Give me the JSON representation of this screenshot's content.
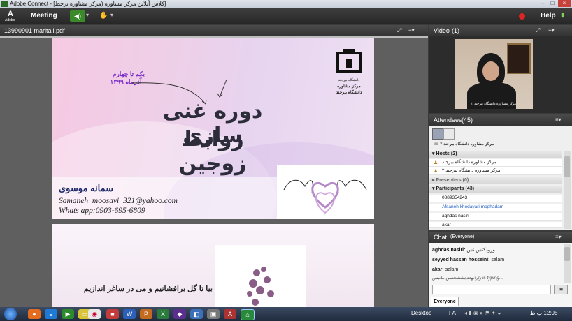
{
  "window": {
    "title": "[کلاس آنلاین مرکز مشاوره (مرکز مشاوره برخط] - Adobe Connect",
    "adobe_label": "Adobe",
    "minimize": "–",
    "maximize": "□",
    "close": "×"
  },
  "menubar": {
    "meeting": "Meeting",
    "help": "Help",
    "record_color": "#e02424"
  },
  "share_pod": {
    "title": "13990901 maritall.pdf",
    "slide1": {
      "date_line1": "یکم تا چهارم",
      "date_line2": "آذرماه ۱۳۹۹",
      "title_line1": "دوره غنی سازی",
      "title_line2": "روابط زوجین",
      "logo_line1": "دانشگاه بیرجند",
      "logo_line2": "مرکز مشاوره",
      "logo_line3": "دانشگاه بیرجند",
      "presenter_name": "سمانه موسوی",
      "email": "Samaneh_moosavi_321@yahoo.com",
      "whatsapp": "Whats app:0903-695-6809"
    },
    "slide2": {
      "text": "بیا تا گل برافشانیم و می در ساغر اندازیم"
    }
  },
  "video_pod": {
    "title": "Video",
    "count": "(1)",
    "caption": "مرکز مشاوره دانشگاه بیرجند ۲"
  },
  "attendees_pod": {
    "title": "Attendees",
    "count": "(45)",
    "me": "مرکز مشاوره دانشگاه بیرجند ۲",
    "hosts_label": "Hosts",
    "hosts_count": "(2)",
    "hosts": [
      "مرکز مشاوره دانشگاه بیرجند",
      "مرکز مشاوره دانشگاه بیرجند ۲"
    ],
    "presenters_label": "Presenters",
    "presenters_count": "(0)",
    "participants_label": "Participants",
    "participants_count": "(43)",
    "participants": [
      "0889354243",
      "Afsaneh khodayari moghadam",
      "aghdas nasiri",
      "akar"
    ]
  },
  "chat_pod": {
    "title": "Chat",
    "scope": "(Everyone)",
    "messages": [
      {
        "name": "aghdas nasiri:",
        "text": "ورودکنس نس"
      },
      {
        "name": "seyyed hassan hosseini:",
        "text": "salam"
      },
      {
        "name": "akar:",
        "text": "salam"
      }
    ],
    "typing": "زارانهعده‌ششحسن مانیس is typing...",
    "tab": "Everyone"
  },
  "taskbar": {
    "desktop": "Desktop",
    "lang": "FA",
    "clock": "12:05 ب.ظ"
  },
  "colors": {
    "accent_blue": "#1f5fbf",
    "title_dark": "#2c2c3a",
    "presenter_navy": "#1f2a6b"
  }
}
